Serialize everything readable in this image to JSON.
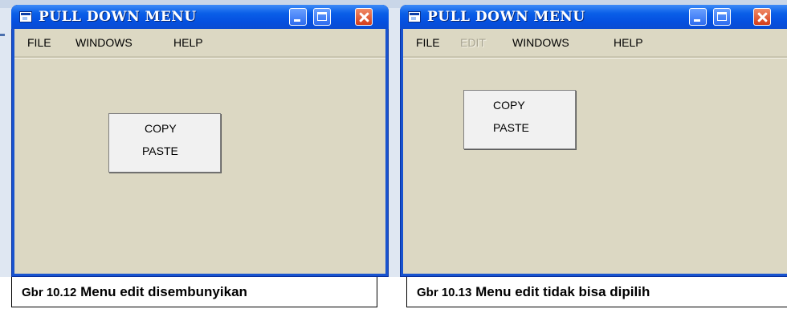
{
  "windows": [
    {
      "title": "PULL DOWN MENU",
      "menu": [
        {
          "label": "FILE",
          "enabled": true
        },
        {
          "label": "WINDOWS",
          "enabled": true
        },
        {
          "label": "HELP",
          "enabled": true
        }
      ],
      "popup_items": [
        "COPY",
        "PASTE"
      ],
      "caption_number": "Gbr 10.12",
      "caption_text": " Menu edit disembunyikan"
    },
    {
      "title": "PULL DOWN MENU",
      "menu": [
        {
          "label": "FILE",
          "enabled": true
        },
        {
          "label": "EDIT",
          "enabled": false
        },
        {
          "label": "WINDOWS",
          "enabled": true
        },
        {
          "label": "HELP",
          "enabled": true
        }
      ],
      "popup_items": [
        "COPY",
        "PASTE"
      ],
      "caption_number": "Gbr 10.13",
      "caption_text": " Menu edit tidak bisa dipilih"
    }
  ],
  "colors": {
    "titlebar": "#0550e0",
    "client": "#dcd8c3",
    "disabled_text": "#a7a390",
    "close_button": "#d53d1a"
  },
  "icons": [
    "app-icon",
    "minimize-icon",
    "maximize-icon",
    "close-icon"
  ]
}
